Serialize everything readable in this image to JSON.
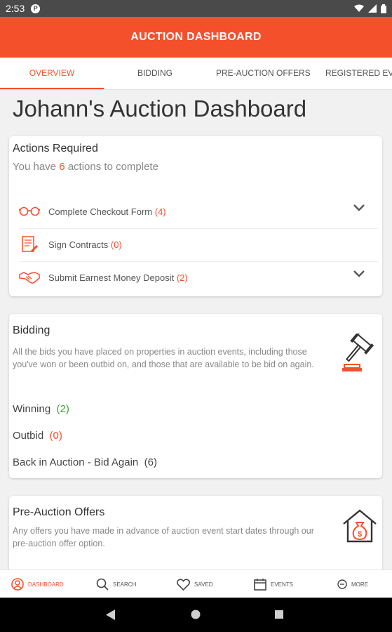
{
  "status_bar": {
    "time": "2:53",
    "app_icon": "P"
  },
  "header": {
    "title": "AUCTION DASHBOARD"
  },
  "tabs": [
    {
      "label": "OVERVIEW",
      "active": true
    },
    {
      "label": "BIDDING",
      "active": false
    },
    {
      "label": "PRE-AUCTION OFFERS",
      "active": false
    },
    {
      "label": "REGISTERED EV",
      "active": false
    }
  ],
  "page": {
    "title": "Johann's Auction Dashboard"
  },
  "actions": {
    "title": "Actions Required",
    "summary_prefix": "You have",
    "summary_count": "6",
    "summary_suffix": "actions to complete",
    "items": [
      {
        "label": "Complete Checkout Form",
        "count": "(4)",
        "icon": "glasses-icon",
        "expandable": true
      },
      {
        "label": "Sign Contracts",
        "count": "(0)",
        "icon": "contract-icon",
        "expandable": false
      },
      {
        "label": "Submit Earnest Money Deposit",
        "count": "(2)",
        "icon": "handshake-icon",
        "expandable": true
      }
    ]
  },
  "bidding": {
    "title": "Bidding",
    "description": "All the bids you have placed on properties in auction events, including those you've won or been outbid on, and those that are available to be bid on again.",
    "icon": "gavel-icon",
    "stats": [
      {
        "label": "Winning",
        "count": "(2)"
      },
      {
        "label": "Outbid",
        "count": "(0)"
      },
      {
        "label": "Back in Auction - Bid Again",
        "count": "(6)"
      }
    ]
  },
  "pre_auction": {
    "title": "Pre-Auction Offers",
    "description": "Any offers you have made in advance of auction event start dates through our pre-auction offer option.",
    "icon": "money-house-icon"
  },
  "bottom_nav": [
    {
      "label": "DASHBOARD",
      "icon": "user-circle-icon",
      "active": true
    },
    {
      "label": "SEARCH",
      "icon": "search-icon",
      "active": false
    },
    {
      "label": "SAVED",
      "icon": "heart-icon",
      "active": false
    },
    {
      "label": "EVENTS",
      "icon": "calendar-icon",
      "active": false
    },
    {
      "label": "MORE",
      "icon": "more-icon",
      "active": false
    }
  ],
  "colors": {
    "accent": "#f5502c",
    "positive": "#3aa33a",
    "status_bar": "#4a4a4a"
  }
}
